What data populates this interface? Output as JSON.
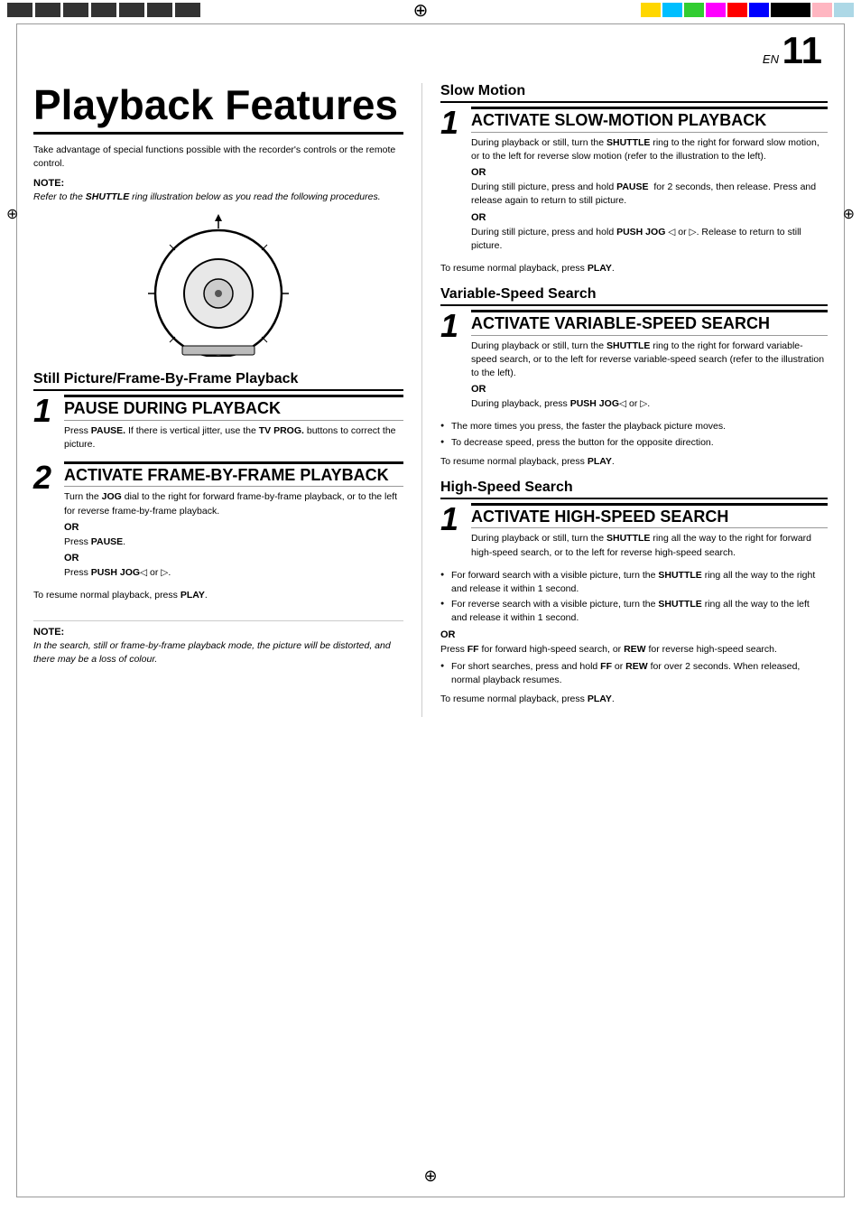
{
  "colors": {
    "yellow": "#FFD700",
    "cyan": "#00BFFF",
    "green": "#32CD32",
    "magenta": "#FF00FF",
    "red": "#FF0000",
    "blue": "#0000FF",
    "black": "#000000",
    "pink": "#FFB6C1",
    "lightblue": "#ADD8E6"
  },
  "page": {
    "en_label": "EN",
    "page_number": "11"
  },
  "left_col": {
    "title": "Playback Features",
    "intro": "Take advantage of special functions possible with the recorder's controls or the remote control.",
    "note_heading": "NOTE:",
    "note_italic": "Refer to the SHUTTLE ring illustration below as you read the following procedures.",
    "still_section": {
      "heading": "Still Picture/Frame-By-Frame Playback",
      "step1_title": "PAUSE DURING PLAYBACK",
      "step1_body": "Press PAUSE. If there is vertical jitter, use the TV PROG. buttons to correct the picture.",
      "step2_title": "ACTIVATE FRAME-BY-FRAME PLAYBACK",
      "step2_body": "Turn the JOG dial to the right for forward frame-by-frame playback, or to the left for reverse frame-by-frame playback.",
      "step2_or1": "OR",
      "step2_or1_text": "Press PAUSE.",
      "step2_or2": "OR",
      "step2_or2_text": "Press PUSH JOG◁ or ▷.",
      "resume": "To resume normal playback, press PLAY."
    },
    "note_bottom": {
      "heading": "NOTE:",
      "italic": "In the search, still or frame-by-frame playback mode, the picture will be distorted, and there may be a loss of colour."
    }
  },
  "right_col": {
    "slow_section": {
      "heading": "Slow Motion",
      "step1_title": "ACTIVATE SLOW-MOTION PLAYBACK",
      "step1_body": "During playback or still, turn the SHUTTLE ring to the right for forward slow motion, or to the left for reverse slow motion (refer to the illustration to the left).",
      "or1": "OR",
      "or1_body": "During still picture, press and hold PAUSE  for 2 seconds, then release. Press and release again to return to still picture.",
      "or2": "OR",
      "or2_body": "During still picture, press and hold PUSH JOG ◁ or ▷. Release to return to still picture.",
      "resume": "To resume normal playback, press PLAY."
    },
    "variable_section": {
      "heading": "Variable-Speed Search",
      "step1_title": "ACTIVATE VARIABLE-SPEED SEARCH",
      "step1_body": "During playback or still, turn the SHUTTLE ring to the right for forward variable-speed search, or to the left for reverse variable-speed search (refer to the illustration to the left).",
      "or1": "OR",
      "or1_body": "During playback, press PUSH JOG◁ or ▷.",
      "bullets": [
        "The more times you press, the faster the playback picture moves.",
        "To decrease speed, press the button for the opposite direction."
      ],
      "resume": "To resume normal playback, press PLAY."
    },
    "highspeed_section": {
      "heading": "High-Speed Search",
      "step1_title": "ACTIVATE HIGH-SPEED SEARCH",
      "step1_body": "During playback or still, turn the SHUTTLE ring all the way to the right for forward high-speed search, or to the left for reverse high-speed search.",
      "bullets": [
        "For forward search with a visible picture, turn the SHUTTLE ring all the way to the right and release it within 1 second.",
        "For reverse search with a visible picture, turn the SHUTTLE ring all the way to the left and release it within 1 second."
      ],
      "or1": "OR",
      "or1_body": "Press FF for forward high-speed search, or REW for reverse high-speed search.",
      "bullets2": [
        "For short searches, press and hold FF or REW for over 2 seconds. When released, normal playback resumes."
      ],
      "resume": "To resume normal playback, press PLAY."
    }
  }
}
